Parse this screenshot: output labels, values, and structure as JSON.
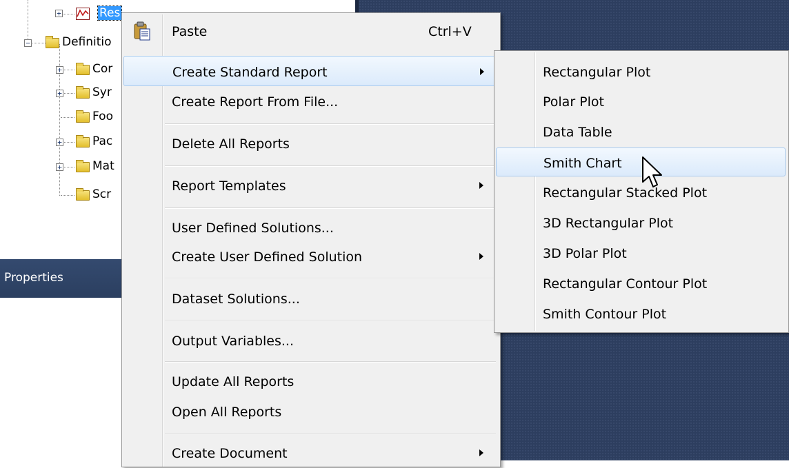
{
  "tree": {
    "items": [
      {
        "label": "Res",
        "kind": "results",
        "selected": true
      },
      {
        "label": "Definitio",
        "kind": "folder"
      },
      {
        "label": "Cor",
        "kind": "folder"
      },
      {
        "label": "Syr",
        "kind": "folder"
      },
      {
        "label": "Foo",
        "kind": "folder"
      },
      {
        "label": "Pac",
        "kind": "folder"
      },
      {
        "label": "Mat",
        "kind": "folder"
      },
      {
        "label": "Scr",
        "kind": "folder"
      }
    ]
  },
  "properties": {
    "title": "Properties"
  },
  "context_menu": {
    "items": [
      {
        "label": "Paste",
        "shortcut": "Ctrl+V",
        "icon": "paste-icon"
      },
      {
        "label": "Create Standard Report",
        "has_submenu": true,
        "highlighted": true
      },
      {
        "label": "Create Report From File..."
      },
      {
        "label": "Delete All Reports"
      },
      {
        "label": "Report Templates",
        "has_submenu": true
      },
      {
        "label": "User Defined Solutions..."
      },
      {
        "label": "Create User Defined Solution",
        "has_submenu": true
      },
      {
        "label": "Dataset Solutions..."
      },
      {
        "label": "Output Variables..."
      },
      {
        "label": "Update All Reports"
      },
      {
        "label": "Open All Reports"
      },
      {
        "label": "Create Document",
        "has_submenu": true
      }
    ]
  },
  "submenu": {
    "items": [
      {
        "label": "Rectangular Plot"
      },
      {
        "label": "Polar Plot"
      },
      {
        "label": "Data Table"
      },
      {
        "label": "Smith Chart",
        "highlighted": true
      },
      {
        "label": "Rectangular Stacked Plot"
      },
      {
        "label": "3D Rectangular Plot"
      },
      {
        "label": "3D Polar Plot"
      },
      {
        "label": "Rectangular Contour Plot"
      },
      {
        "label": "Smith Contour Plot"
      }
    ]
  },
  "colors": {
    "menu_bg": "#f0f0f0",
    "highlight_border": "#a9cbef",
    "desktop_bg": "#2d3e5f",
    "properties_header_bg": "#344a6f",
    "selection_bg": "#3399ff"
  }
}
